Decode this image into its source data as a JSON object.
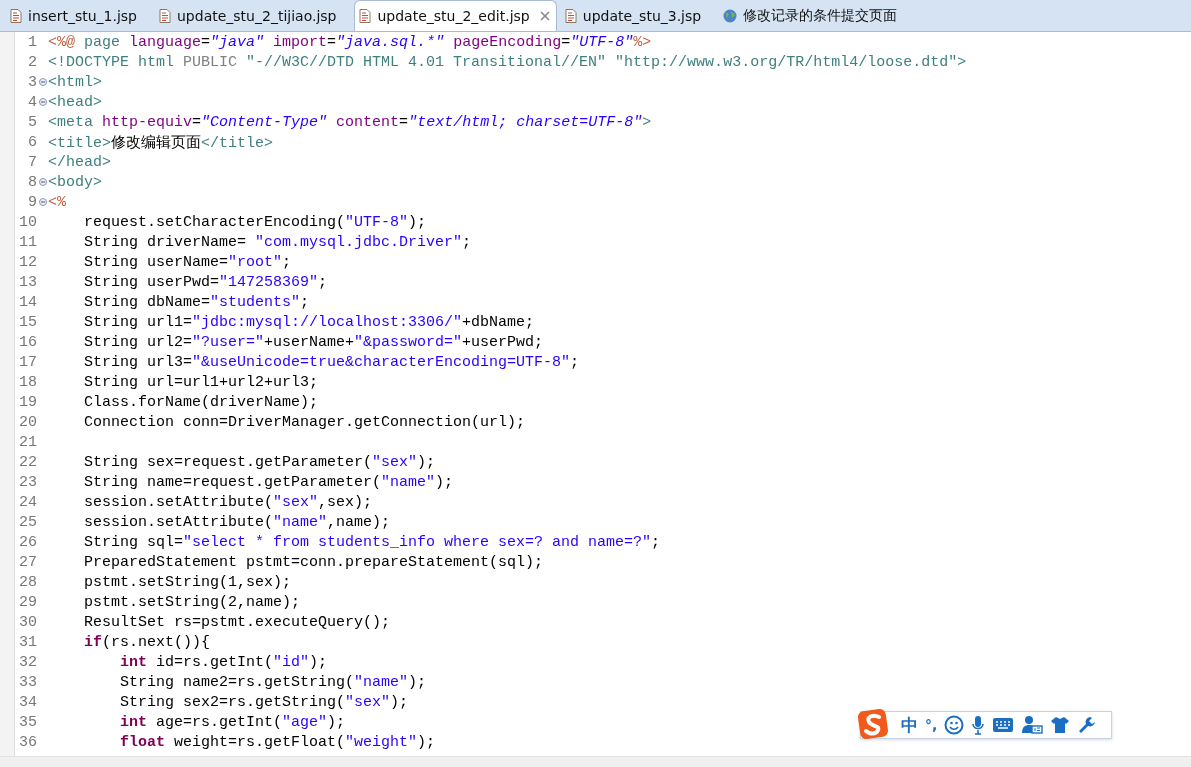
{
  "tabs": [
    {
      "label": "insert_stu_1.jsp",
      "kind": "file",
      "selected": false
    },
    {
      "label": "update_stu_2_tijiao.jsp",
      "kind": "file",
      "selected": false
    },
    {
      "label": "update_stu_2_edit.jsp",
      "kind": "file",
      "selected": true
    },
    {
      "label": "update_stu_3.jsp",
      "kind": "file",
      "selected": false
    },
    {
      "label": "修改记录的条件提交页面",
      "kind": "web",
      "selected": false
    }
  ],
  "editor": {
    "lines": [
      {
        "n": "1",
        "fold": false,
        "segs": [
          {
            "kind": "jsp",
            "text": "<%@"
          },
          {
            "kind": "tag",
            "text": " page"
          },
          {
            "kind": "attr",
            "text": " language"
          },
          {
            "kind": "p",
            "text": "="
          },
          {
            "kind": "aval",
            "text": "\"java\""
          },
          {
            "kind": "attr",
            "text": " import"
          },
          {
            "kind": "p",
            "text": "="
          },
          {
            "kind": "aval",
            "text": "\"java.sql.*\""
          },
          {
            "kind": "attr",
            "text": " pageEncoding"
          },
          {
            "kind": "p",
            "text": "="
          },
          {
            "kind": "aval",
            "text": "\"UTF-8\""
          },
          {
            "kind": "jsp",
            "text": "%>"
          }
        ]
      },
      {
        "n": "2",
        "fold": false,
        "segs": [
          {
            "kind": "tag",
            "text": "<!DOCTYPE html"
          },
          {
            "kind": "dt",
            "text": " PUBLIC"
          },
          {
            "kind": "tag",
            "text": " \"-//W3C//DTD HTML 4.01 Transitional//EN\" \"http://www.w3.org/TR/html4/loose.dtd\">"
          }
        ]
      },
      {
        "n": "3",
        "fold": true,
        "segs": [
          {
            "kind": "tag",
            "text": "<html>"
          }
        ]
      },
      {
        "n": "4",
        "fold": true,
        "segs": [
          {
            "kind": "tag",
            "text": "<head>"
          }
        ]
      },
      {
        "n": "5",
        "fold": false,
        "segs": [
          {
            "kind": "tag",
            "text": "<meta"
          },
          {
            "kind": "attr",
            "text": " http-equiv"
          },
          {
            "kind": "p",
            "text": "="
          },
          {
            "kind": "aval",
            "text": "\"Content-Type\""
          },
          {
            "kind": "attr",
            "text": " content"
          },
          {
            "kind": "p",
            "text": "="
          },
          {
            "kind": "aval",
            "text": "\"text/html; charset=UTF-8\""
          },
          {
            "kind": "tag",
            "text": ">"
          }
        ]
      },
      {
        "n": "6",
        "fold": false,
        "segs": [
          {
            "kind": "tag",
            "text": "<title>"
          },
          {
            "kind": "p",
            "text": "修改编辑页面"
          },
          {
            "kind": "tag",
            "text": "</title>"
          }
        ]
      },
      {
        "n": "7",
        "fold": false,
        "segs": [
          {
            "kind": "tag",
            "text": "</head>"
          }
        ]
      },
      {
        "n": "8",
        "fold": true,
        "segs": [
          {
            "kind": "tag",
            "text": "<body>"
          }
        ]
      },
      {
        "n": "9",
        "fold": true,
        "segs": [
          {
            "kind": "jsp",
            "text": "<%"
          }
        ]
      },
      {
        "n": "10",
        "fold": false,
        "segs": [
          {
            "kind": "p",
            "text": "    request.setCharacterEncoding("
          },
          {
            "kind": "str",
            "text": "\"UTF-8\""
          },
          {
            "kind": "p",
            "text": ");"
          }
        ]
      },
      {
        "n": "11",
        "fold": false,
        "segs": [
          {
            "kind": "p",
            "text": "    String driverName= "
          },
          {
            "kind": "str",
            "text": "\"com.mysql.jdbc.Driver\""
          },
          {
            "kind": "p",
            "text": ";"
          }
        ]
      },
      {
        "n": "12",
        "fold": false,
        "segs": [
          {
            "kind": "p",
            "text": "    String userName="
          },
          {
            "kind": "str",
            "text": "\"root\""
          },
          {
            "kind": "p",
            "text": ";"
          }
        ]
      },
      {
        "n": "13",
        "fold": false,
        "segs": [
          {
            "kind": "p",
            "text": "    String userPwd="
          },
          {
            "kind": "str",
            "text": "\"147258369\""
          },
          {
            "kind": "p",
            "text": ";"
          }
        ]
      },
      {
        "n": "14",
        "fold": false,
        "segs": [
          {
            "kind": "p",
            "text": "    String dbName="
          },
          {
            "kind": "str",
            "text": "\"students\""
          },
          {
            "kind": "p",
            "text": ";"
          }
        ]
      },
      {
        "n": "15",
        "fold": false,
        "segs": [
          {
            "kind": "p",
            "text": "    String url1="
          },
          {
            "kind": "str",
            "text": "\"jdbc:mysql://localhost:3306/\""
          },
          {
            "kind": "p",
            "text": "+dbName;"
          }
        ]
      },
      {
        "n": "16",
        "fold": false,
        "segs": [
          {
            "kind": "p",
            "text": "    String url2="
          },
          {
            "kind": "str",
            "text": "\"?user=\""
          },
          {
            "kind": "p",
            "text": "+userName+"
          },
          {
            "kind": "str",
            "text": "\"&password=\""
          },
          {
            "kind": "p",
            "text": "+userPwd;"
          }
        ]
      },
      {
        "n": "17",
        "fold": false,
        "segs": [
          {
            "kind": "p",
            "text": "    String url3="
          },
          {
            "kind": "str",
            "text": "\"&useUnicode=true&characterEncoding=UTF-8\""
          },
          {
            "kind": "p",
            "text": ";"
          }
        ]
      },
      {
        "n": "18",
        "fold": false,
        "segs": [
          {
            "kind": "p",
            "text": "    String url=url1+url2+url3;"
          }
        ]
      },
      {
        "n": "19",
        "fold": false,
        "segs": [
          {
            "kind": "p",
            "text": "    Class.forName(driverName);"
          }
        ]
      },
      {
        "n": "20",
        "fold": false,
        "segs": [
          {
            "kind": "p",
            "text": "    Connection conn=DriverManager.getConnection(url);"
          }
        ]
      },
      {
        "n": "21",
        "fold": false
      },
      {
        "n": "22",
        "fold": false,
        "segs": [
          {
            "kind": "p",
            "text": "    String sex=request.getParameter("
          },
          {
            "kind": "str",
            "text": "\"sex\""
          },
          {
            "kind": "p",
            "text": ");"
          }
        ]
      },
      {
        "n": "23",
        "fold": false,
        "segs": [
          {
            "kind": "p",
            "text": "    String name=request.getParameter("
          },
          {
            "kind": "str",
            "text": "\"name\""
          },
          {
            "kind": "p",
            "text": ");"
          }
        ]
      },
      {
        "n": "24",
        "fold": false,
        "segs": [
          {
            "kind": "p",
            "text": "    session.setAttribute("
          },
          {
            "kind": "str",
            "text": "\"sex\""
          },
          {
            "kind": "p",
            "text": ",sex);"
          }
        ]
      },
      {
        "n": "25",
        "fold": false,
        "segs": [
          {
            "kind": "p",
            "text": "    session.setAttribute("
          },
          {
            "kind": "str",
            "text": "\"name\""
          },
          {
            "kind": "p",
            "text": ",name);"
          }
        ]
      },
      {
        "n": "26",
        "fold": false,
        "segs": [
          {
            "kind": "p",
            "text": "    String sql="
          },
          {
            "kind": "str",
            "text": "\"select * from students_info where sex=? and name=?\""
          },
          {
            "kind": "p",
            "text": ";"
          }
        ]
      },
      {
        "n": "27",
        "fold": false,
        "segs": [
          {
            "kind": "p",
            "text": "    PreparedStatement pstmt=conn.prepareStatement(sql);"
          }
        ]
      },
      {
        "n": "28",
        "fold": false,
        "segs": [
          {
            "kind": "p",
            "text": "    pstmt.setString(1,sex);"
          }
        ]
      },
      {
        "n": "29",
        "fold": false,
        "segs": [
          {
            "kind": "p",
            "text": "    pstmt.setString(2,name);"
          }
        ]
      },
      {
        "n": "30",
        "fold": false,
        "segs": [
          {
            "kind": "p",
            "text": "    ResultSet rs=pstmt.executeQuery();"
          }
        ]
      },
      {
        "n": "31",
        "fold": false,
        "segs": [
          {
            "kind": "kw",
            "text": "    if"
          },
          {
            "kind": "p",
            "text": "(rs.next()){"
          }
        ]
      },
      {
        "n": "32",
        "fold": false,
        "segs": [
          {
            "kind": "kw",
            "text": "        int"
          },
          {
            "kind": "p",
            "text": " id=rs.getInt("
          },
          {
            "kind": "str",
            "text": "\"id\""
          },
          {
            "kind": "p",
            "text": ");"
          }
        ]
      },
      {
        "n": "33",
        "fold": false,
        "segs": [
          {
            "kind": "p",
            "text": "        String name2=rs.getString("
          },
          {
            "kind": "str",
            "text": "\"name\""
          },
          {
            "kind": "p",
            "text": ");"
          }
        ]
      },
      {
        "n": "34",
        "fold": false,
        "segs": [
          {
            "kind": "p",
            "text": "        String sex2=rs.getString("
          },
          {
            "kind": "str",
            "text": "\"sex\""
          },
          {
            "kind": "p",
            "text": ");"
          }
        ]
      },
      {
        "n": "35",
        "fold": false,
        "segs": [
          {
            "kind": "kw",
            "text": "        int"
          },
          {
            "kind": "p",
            "text": " age=rs.getInt("
          },
          {
            "kind": "str",
            "text": "\"age\""
          },
          {
            "kind": "p",
            "text": ");"
          }
        ]
      },
      {
        "n": "36",
        "fold": false,
        "segs": [
          {
            "kind": "kw",
            "text": "        float"
          },
          {
            "kind": "p",
            "text": " weight=rs.getFloat("
          },
          {
            "kind": "str",
            "text": "\"weight\""
          },
          {
            "kind": "p",
            "text": ");"
          }
        ]
      }
    ]
  },
  "ime_toolbar": {
    "mode": "中",
    "punctuation": "°,"
  }
}
